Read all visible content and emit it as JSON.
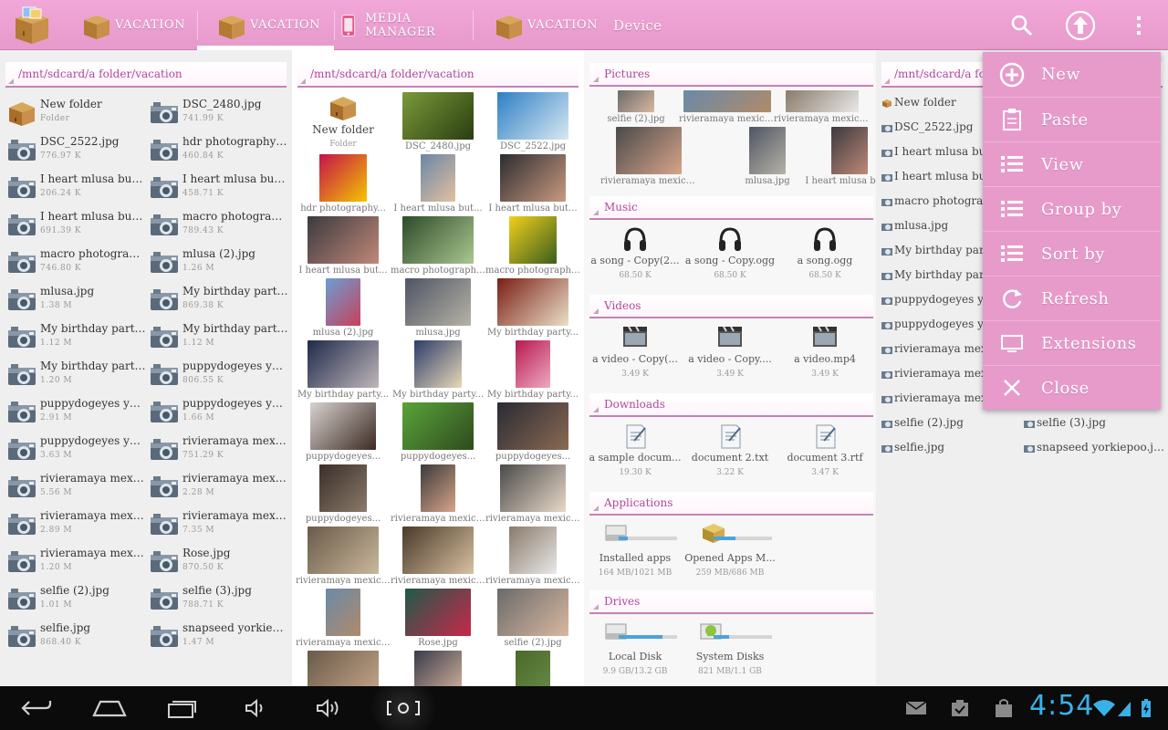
{
  "topbar": {
    "tabs": [
      {
        "label": "VACATION",
        "active": false
      },
      {
        "label": "VACATION",
        "active": true
      },
      {
        "label": "MEDIA MANAGER",
        "active": false
      },
      {
        "label": "VACATION",
        "active": false
      },
      {
        "label": "Device",
        "active": false
      }
    ],
    "actions": [
      "search-icon",
      "up-arrow-icon",
      "overflow-menu-icon"
    ],
    "accent_color": "#e79acb"
  },
  "pane1": {
    "path": "/mnt/sdcard/a folder/vacation",
    "items": [
      {
        "name": "New folder",
        "size": "Folder",
        "type": "folder"
      },
      {
        "name": "DSC_2480.jpg",
        "size": "741.99 K",
        "type": "image"
      },
      {
        "name": "DSC_2522.jpg",
        "size": "776.97 K",
        "type": "image"
      },
      {
        "name": "hdr photography p...",
        "size": "460.84 K",
        "type": "image"
      },
      {
        "name": "I heart mlusa but fi...",
        "size": "206.24 K",
        "type": "image"
      },
      {
        "name": "I heart mlusa but fi...",
        "size": "458.71 K",
        "type": "image"
      },
      {
        "name": "I heart mlusa but fi...",
        "size": "691.39 K",
        "type": "image"
      },
      {
        "name": "macro photograph...",
        "size": "789.43 K",
        "type": "image"
      },
      {
        "name": "macro photograph...",
        "size": "746.80 K",
        "type": "image"
      },
      {
        "name": "mlusa (2).jpg",
        "size": "1.26 M",
        "type": "image"
      },
      {
        "name": "mlusa.jpg",
        "size": "1.38 M",
        "type": "image"
      },
      {
        "name": "My birthday party...",
        "size": "869.38 K",
        "type": "image"
      },
      {
        "name": "My birthday party...",
        "size": "1.12 M",
        "type": "image"
      },
      {
        "name": "My birthday party...",
        "size": "1.12 M",
        "type": "image"
      },
      {
        "name": "My birthday party...",
        "size": "1.20 M",
        "type": "image"
      },
      {
        "name": "puppydogeyes yor...",
        "size": "806.55 K",
        "type": "image"
      },
      {
        "name": "puppydogeyes yor...",
        "size": "2.91 M",
        "type": "image"
      },
      {
        "name": "puppydogeyes yor...",
        "size": "1.66 M",
        "type": "image"
      },
      {
        "name": "puppydogeyes yor...",
        "size": "3.63 M",
        "type": "image"
      },
      {
        "name": "rivieramaya mexic...",
        "size": "751.29 K",
        "type": "image"
      },
      {
        "name": "rivieramaya mexic...",
        "size": "5.56 M",
        "type": "image"
      },
      {
        "name": "rivieramaya mexic...",
        "size": "2.28 M",
        "type": "image"
      },
      {
        "name": "rivieramaya mexic...",
        "size": "2.89 M",
        "type": "image"
      },
      {
        "name": "rivieramaya mexic...",
        "size": "7.35 M",
        "type": "image"
      },
      {
        "name": "rivieramaya mexic...",
        "size": "1.20 M",
        "type": "image"
      },
      {
        "name": "Rose.jpg",
        "size": "870.50 K",
        "type": "image"
      },
      {
        "name": "selfie (2).jpg",
        "size": "1.01 M",
        "type": "image"
      },
      {
        "name": "selfie (3).jpg",
        "size": "788.71 K",
        "type": "image"
      },
      {
        "name": "selfie.jpg",
        "size": "868.40 K",
        "type": "image"
      },
      {
        "name": "snapseed yorkiepo...",
        "size": "1.47 M",
        "type": "image"
      }
    ]
  },
  "pane2": {
    "path": "/mnt/sdcard/a folder/vacation",
    "items": [
      {
        "name": "New folder",
        "sub": "Folder",
        "type": "folder"
      },
      {
        "name": "DSC_2480.jpg",
        "colors": [
          "#7a9a3a",
          "#2a3d10"
        ]
      },
      {
        "name": "DSC_2522.jpg",
        "colors": [
          "#2d7fc7",
          "#d9e8f0"
        ]
      },
      {
        "name": "hdr photography...",
        "colors": [
          "#c4124a",
          "#f5c400"
        ]
      },
      {
        "name": "I heart mlusa but...",
        "colors": [
          "#6a86a6",
          "#e2c1a0"
        ]
      },
      {
        "name": "I heart mlusa but...",
        "colors": [
          "#2c2c30",
          "#c99a80"
        ]
      },
      {
        "name": "I heart mlusa but...",
        "colors": [
          "#3a3a3f",
          "#c08878"
        ]
      },
      {
        "name": "macro photography...",
        "colors": [
          "#2d4a2a",
          "#a9c78e"
        ]
      },
      {
        "name": "macro photography...",
        "colors": [
          "#f2d01a",
          "#3a5d1e"
        ]
      },
      {
        "name": "mlusa (2).jpg",
        "colors": [
          "#6a9ed5",
          "#c8405a"
        ]
      },
      {
        "name": "mlusa.jpg",
        "colors": [
          "#4e5563",
          "#b7b2a7"
        ]
      },
      {
        "name": "My birthday party...",
        "colors": [
          "#7a1e14",
          "#eae0c8"
        ]
      },
      {
        "name": "My birthday party...",
        "colors": [
          "#1e2a4a",
          "#c0b6ba"
        ]
      },
      {
        "name": "My birthday party...",
        "colors": [
          "#2c3d6a",
          "#e8d8b8"
        ]
      },
      {
        "name": "My birthday party...",
        "colors": [
          "#b6194e",
          "#efa9c4"
        ]
      },
      {
        "name": "puppydogeyes...",
        "colors": [
          "#d8d2d0",
          "#3c2a22"
        ]
      },
      {
        "name": "puppydogeyes...",
        "colors": [
          "#5aa43a",
          "#2e4a1e"
        ]
      },
      {
        "name": "puppydogeyes...",
        "colors": [
          "#2a2a34",
          "#8a6a52"
        ]
      },
      {
        "name": "puppydogeyes...",
        "colors": [
          "#3a2e28",
          "#8a7a6a"
        ]
      },
      {
        "name": "rivieramaya mexico...",
        "colors": [
          "#3a3a3a",
          "#d8a48a"
        ]
      },
      {
        "name": "rivieramaya mexico...",
        "colors": [
          "#4a4a4a",
          "#e8d8c8"
        ]
      },
      {
        "name": "rivieramaya mexico...",
        "colors": [
          "#6a5a4a",
          "#c9b89a"
        ]
      },
      {
        "name": "rivieramaya mexico...",
        "colors": [
          "#4a3a2a",
          "#d8c0a0"
        ]
      },
      {
        "name": "rivieramaya mexico...",
        "colors": [
          "#8a7a6a",
          "#e8e8e8"
        ]
      },
      {
        "name": "rivieramaya mexico...",
        "colors": [
          "#6a8aa8",
          "#b08a6a"
        ]
      },
      {
        "name": "Rose.jpg",
        "colors": [
          "#1e5a4a",
          "#c8284a"
        ]
      },
      {
        "name": "selfie (2).jpg",
        "colors": [
          "#6a6a6a",
          "#d8b8a0"
        ]
      },
      {
        "name": "",
        "colors": [
          "#6a5a4a",
          "#c8a88a"
        ]
      },
      {
        "name": "",
        "colors": [
          "#3a3a4a",
          "#d8b8a0"
        ]
      },
      {
        "name": "",
        "colors": [
          "#4a6a2a",
          "#6a8a4a"
        ]
      }
    ]
  },
  "pane3": {
    "pictures": {
      "label": "Pictures",
      "items": [
        {
          "name": "selfie (2).jpg",
          "colors": [
            "#6a6a6a",
            "#d8b8a0"
          ]
        },
        {
          "name": "rivieramaya mexico...",
          "colors": [
            "#6a8aa8",
            "#b08a6a"
          ]
        },
        {
          "name": "rivieramaya mexico...",
          "colors": [
            "#8a7a6a",
            "#e8e8e8"
          ]
        },
        {
          "name": "rivieramaya mexico...",
          "colors": [
            "#4a4a4a",
            "#d8a48a"
          ]
        },
        {
          "name": "mlusa.jpg",
          "colors": [
            "#4e5563",
            "#b7b2a7"
          ]
        },
        {
          "name": "I heart mlusa but...",
          "colors": [
            "#3a3a3f",
            "#c08878"
          ]
        }
      ]
    },
    "music": {
      "label": "Music",
      "items": [
        {
          "name": "a song - Copy(2...",
          "size": "68.50 K"
        },
        {
          "name": "a song - Copy.ogg",
          "size": "68.50 K"
        },
        {
          "name": "a song.ogg",
          "size": "68.50 K"
        }
      ]
    },
    "videos": {
      "label": "Videos",
      "items": [
        {
          "name": "a video - Copy(...",
          "size": "3.49 K"
        },
        {
          "name": "a video - Copy....",
          "size": "3.49 K"
        },
        {
          "name": "a video.mp4",
          "size": "3.49 K"
        }
      ]
    },
    "downloads": {
      "label": "Downloads",
      "items": [
        {
          "name": "a sample docum...",
          "size": "19.30 K"
        },
        {
          "name": "document 2.txt",
          "size": "3.22 K"
        },
        {
          "name": "document 3.rtf",
          "size": "3.47 K"
        }
      ]
    },
    "applications": {
      "label": "Applications",
      "items": [
        {
          "name": "Installed apps",
          "size": "164 MB/1021 MB",
          "usage": 0.16
        },
        {
          "name": "Opened Apps M...",
          "size": "259 MB/686 MB",
          "usage": 0.38
        }
      ]
    },
    "drives": {
      "label": "Drives",
      "items": [
        {
          "name": "Local Disk",
          "size": "9.9 GB/13.2 GB",
          "usage": 0.75
        },
        {
          "name": "System Disks",
          "size": "821 MB/1.1 GB",
          "usage": 0.27
        }
      ]
    }
  },
  "pane4": {
    "path": "/mnt/sdcard/a folder/vacation",
    "col1": [
      "New folder",
      "DSC_2522.jpg",
      "I heart mlusa but fi",
      "I heart mlusa but fi",
      "macro photograph",
      "mlusa.jpg",
      "My birthday party",
      "My birthday party",
      "puppydogeyes yor",
      "puppydogeyes yor",
      "rivieramaya mexic",
      "rivieramaya mexic",
      "rivieramaya mexic",
      "selfie (2).jpg",
      "selfie.jpg"
    ],
    "col2": [
      "selfie (3).jpg",
      "snapseed yorkiepoo.jpg"
    ]
  },
  "menu": {
    "items": [
      {
        "label": "New",
        "icon": "plus-circle-icon"
      },
      {
        "label": "Paste",
        "icon": "clipboard-icon"
      },
      {
        "label": "View",
        "icon": "list-icon"
      },
      {
        "label": "Group by",
        "icon": "list-icon"
      },
      {
        "label": "Sort by",
        "icon": "list-icon"
      },
      {
        "label": "Refresh",
        "icon": "refresh-icon"
      },
      {
        "label": "Extensions",
        "icon": "monitor-icon"
      },
      {
        "label": "Close",
        "icon": "close-icon"
      }
    ]
  },
  "statusbar": {
    "time": "4:54",
    "clock_color": "#3ab0e8"
  }
}
